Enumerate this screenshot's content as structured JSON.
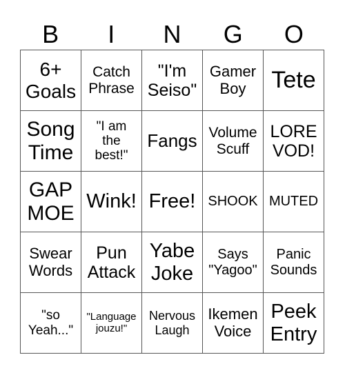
{
  "header": [
    "B",
    "I",
    "N",
    "G",
    "O"
  ],
  "cells": [
    [
      "6+\nGoals",
      "Catch\nPhrase",
      "\"I'm\nSeiso\"",
      "Gamer\nBoy",
      "Tete"
    ],
    [
      "Song\nTime",
      "\"I am\nthe\nbest!\"",
      "Fangs",
      "Volume\nScuff",
      "LORE\nVOD!"
    ],
    [
      "GAP\nMOE",
      "Wink!",
      "Free!",
      "SHOOK",
      "MUTED"
    ],
    [
      "Swear\nWords",
      "Pun\nAttack",
      "Yabe\nJoke",
      "Says\n\"Yagoo\"",
      "Panic\nSounds"
    ],
    [
      "\"so\nYeah...\"",
      "\"Language\njouzu!\"",
      "Nervous\nLaugh",
      "Ikemen\nVoice",
      "Peek\nEntry"
    ]
  ]
}
